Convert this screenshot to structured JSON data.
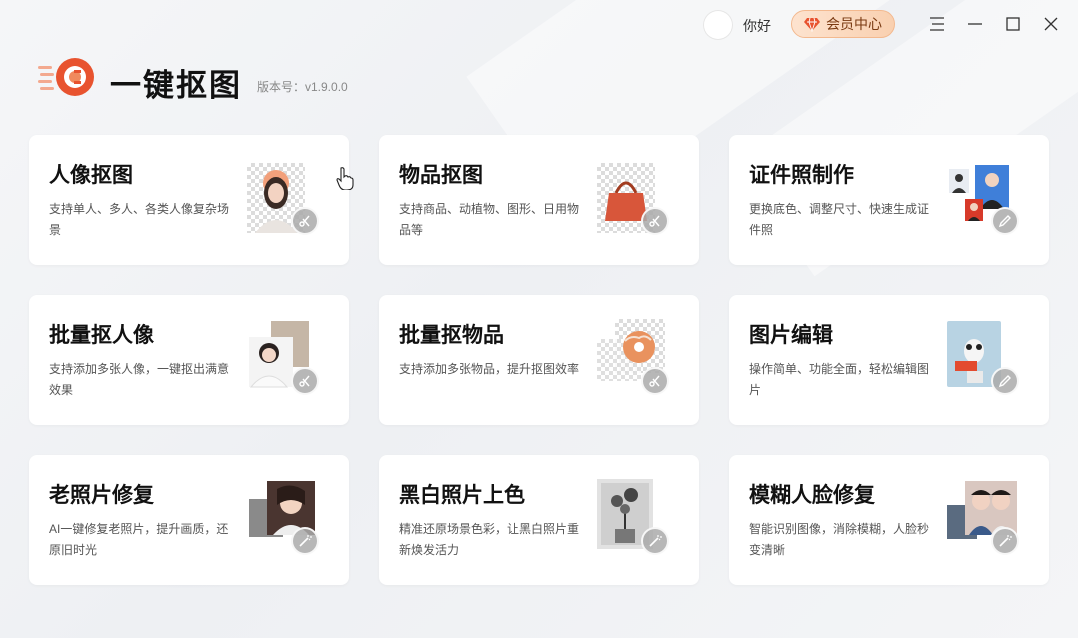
{
  "window": {
    "greeting": "你好",
    "vip_label": "会员中心",
    "icons": [
      "menu-icon",
      "minimize-icon",
      "maximize-icon",
      "close-icon"
    ]
  },
  "brand": {
    "app_name": "一键抠图",
    "version": "版本号：v1.9.0.0",
    "accent_color": "#e8532f"
  },
  "cards": [
    {
      "title": "人像抠图",
      "desc": "支持单人、多人、各类人像复杂场景",
      "badge_icon": "scissors-icon"
    },
    {
      "title": "物品抠图",
      "desc": "支持商品、动植物、图形、日用物品等",
      "badge_icon": "scissors-icon"
    },
    {
      "title": "证件照制作",
      "desc": "更换底色、调整尺寸、快速生成证件照",
      "badge_icon": "pencil-icon"
    },
    {
      "title": "批量抠人像",
      "desc": "支持添加多张人像，一键抠出满意效果",
      "badge_icon": "scissors-icon"
    },
    {
      "title": "批量抠物品",
      "desc": "支持添加多张物品，提升抠图效率",
      "badge_icon": "scissors-icon"
    },
    {
      "title": "图片编辑",
      "desc": "操作简单、功能全面，轻松编辑图片",
      "badge_icon": "pencil-icon"
    },
    {
      "title": "老照片修复",
      "desc": "AI一键修复老照片，提升画质，还原旧时光",
      "badge_icon": "magic-wand-icon"
    },
    {
      "title": "黑白照片上色",
      "desc": "精准还原场景色彩，让黑白照片重新焕发活力",
      "badge_icon": "magic-wand-icon"
    },
    {
      "title": "模糊人脸修复",
      "desc": "智能识别图像，消除模糊，人脸秒变清晰",
      "badge_icon": "magic-wand-icon"
    }
  ]
}
